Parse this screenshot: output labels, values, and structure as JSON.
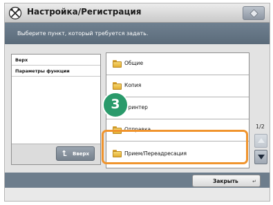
{
  "window": {
    "title": "Настройка/Регистрация"
  },
  "info": {
    "message": "Выберите пункт, который требуется задать."
  },
  "breadcrumb": {
    "items": [
      "Верх",
      "Параметры функции"
    ]
  },
  "up_button": {
    "label": "Вверх"
  },
  "folder_list": [
    {
      "label": "Общие"
    },
    {
      "label": "Копия"
    },
    {
      "label": "Принтер"
    },
    {
      "label": "Отправка"
    },
    {
      "label": "Прием/Переадресация"
    }
  ],
  "pagination": {
    "page": "1/2"
  },
  "close_button": {
    "label": "Закрыть"
  },
  "step": {
    "number": "3"
  },
  "colors": {
    "highlight": "#f0942d",
    "badge": "#2a9a6b",
    "info_bar": "#6f8090"
  }
}
